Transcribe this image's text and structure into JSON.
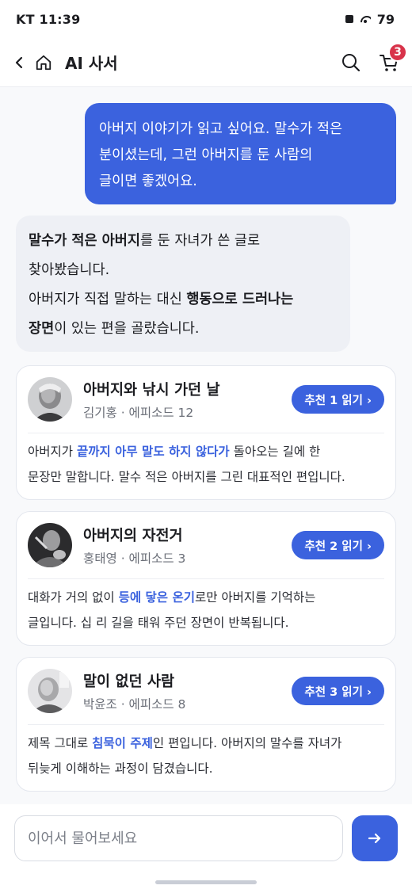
{
  "status_bar": {
    "time": "KT 11:39",
    "battery": "79"
  },
  "header": {
    "title": "AI 사서",
    "cart_count": "3"
  },
  "user_message": {
    "lines": [
      "아버지 이야기가 읽고 싶어요. 말수가 적은",
      "분이셨는데, 그런 아버지를 둔 사람의",
      "글이면 좋겠어요."
    ]
  },
  "ai_message": {
    "line1_bold": "말수가 적은 아버지",
    "line1_rest": "를 둔 자녀가 쓴 글로",
    "line2": "찾아봤습니다.",
    "line3_start": "아버지가 직접 말하는 대신 ",
    "line3_bold": "행동으로 드러나는",
    "line4_bold": "장면",
    "line4_rest": "이 있는 편을 골랐습니다."
  },
  "recommendations": [
    {
      "title": "아버지와 낚시 가던 날",
      "author": "김기홍 · 에피소드 12",
      "button": "추천 1 읽기 ›",
      "desc_pre": "아버지가 ",
      "desc_hl": "끝까지 아무 말도 하지 않다가",
      "desc_post_line1": " 돌아오는 길에 한",
      "desc_line2": "문장만 말합니다. 말수 적은 아버지를 그린 대표적인 편입니다."
    },
    {
      "title": "아버지의 자전거",
      "author": "홍태영 · 에피소드 3",
      "button": "추천 2 읽기 ›",
      "desc_pre": "대화가 거의 없이 ",
      "desc_hl": "등에 닿은 온기",
      "desc_post_line1": "로만 아버지를 기억하는",
      "desc_line2": "글입니다. 십 리 길을 태워 주던 장면이 반복됩니다."
    },
    {
      "title": "말이 없던 사람",
      "author": "박윤조 · 에피소드 8",
      "button": "추천 3 읽기 ›",
      "desc_pre": "제목 그대로 ",
      "desc_hl": "침묵이 주제",
      "desc_post_line1": "인 편입니다. 아버지의 말수를 자녀가",
      "desc_line2": "뒤늦게 이해하는 과정이 담겼습니다."
    }
  ],
  "composer": {
    "placeholder": "이어서 물어보세요"
  },
  "colors": {
    "accent": "#3b62de",
    "badge": "#d8334a",
    "ai_bubble": "#eef0f5"
  },
  "icons": [
    "back-icon",
    "home-icon",
    "search-icon",
    "cart-icon",
    "send-arrow-icon"
  ]
}
